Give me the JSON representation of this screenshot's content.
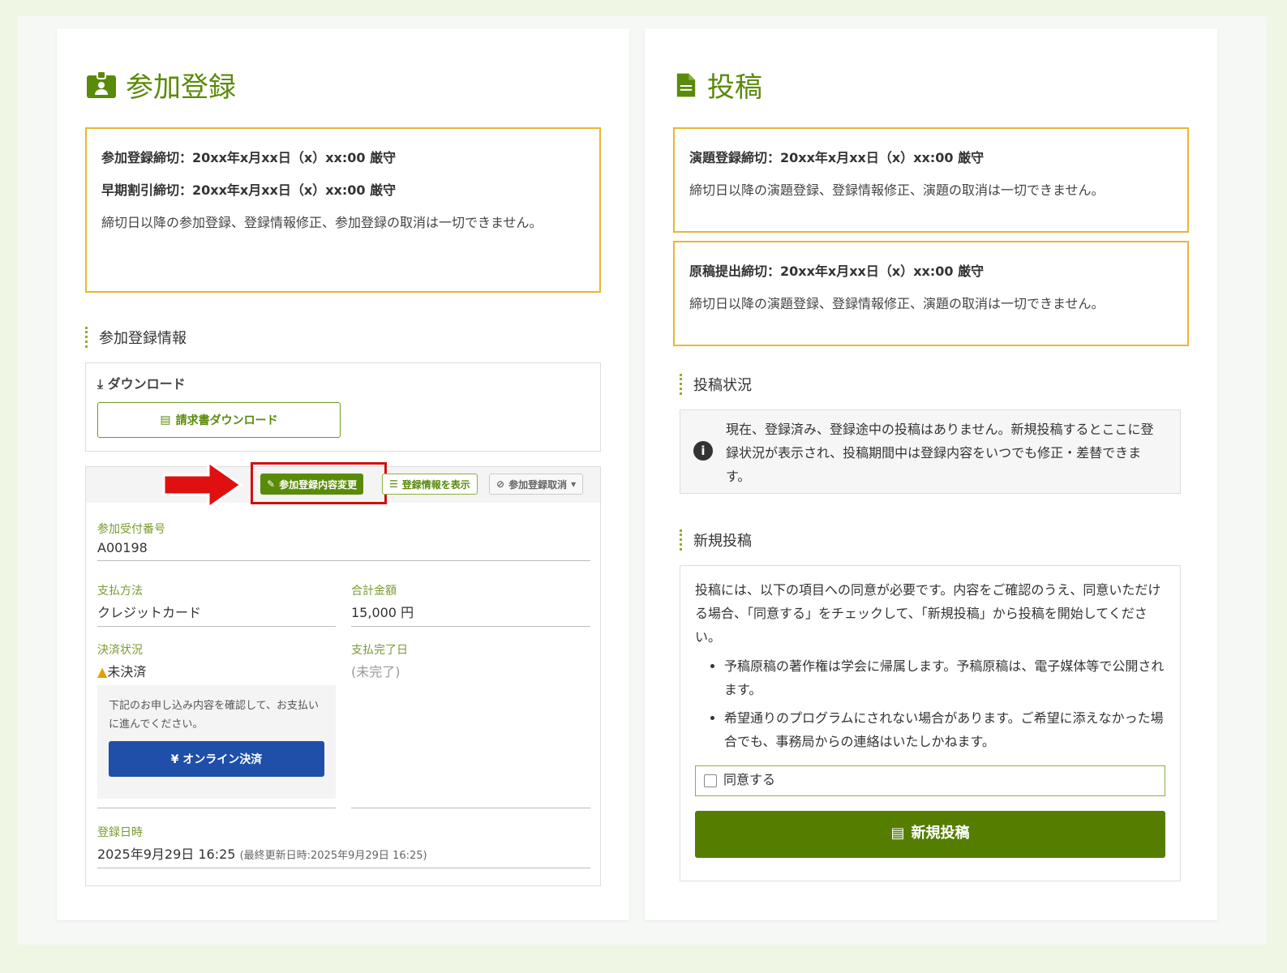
{
  "registration": {
    "title": "参加登録",
    "deadline1": "参加登録締切：20xx年x月xx日（x）xx:00 厳守",
    "deadline2": "早期割引締切：20xx年x月xx日（x）xx:00 厳守",
    "note": "締切日以降の参加登録、登録情報修正、参加登録の取消は一切できません。",
    "section": "参加登録情報",
    "download_label": "ダウンロード",
    "invoice_button": "請求書ダウンロード",
    "edit_button": "参加登録内容変更",
    "view_button": "登録情報を表示",
    "cancel_button": "参加登録取消",
    "receipt_label": "参加受付番号",
    "receipt_value": "A00198",
    "method_label": "支払方法",
    "method_value": "クレジットカード",
    "total_label": "合計金額",
    "total_value": "15,000 円",
    "status_label": "決済状況",
    "status_value": "未決済",
    "paid_label": "支払完了日",
    "paid_value": "(未完了)",
    "pay_note": "下記のお申し込み内容を確認して、お支払いに進んでください。",
    "pay_button": "¥ オンライン決済",
    "date_label": "登録日時",
    "date_value": "2025年9月29日 16:25",
    "updated": "(最終更新日時:2025年9月29日 16:25)"
  },
  "submission": {
    "title": "投稿",
    "deadline1": "演題登録締切：20xx年x月xx日（x）xx:00 厳守",
    "note1": "締切日以降の演題登録、登録情報修正、演題の取消は一切できません。",
    "deadline2": "原稿提出締切：20xx年x月xx日（x）xx:00 厳守",
    "note2": "締切日以降の演題登録、登録情報修正、演題の取消は一切できません。",
    "status_section": "投稿状況",
    "status_info": "現在、登録済み、登録途中の投稿はありません。新規投稿するとここに登録状況が表示され、投稿期間中は登録内容をいつでも修正・差替できます。",
    "new_section": "新規投稿",
    "consent_intro": "投稿には、以下の項目への同意が必要です。内容をご確認のうえ、同意いただける場合、「同意する」をチェックして、「新規投稿」から投稿を開始してください。",
    "items": [
      "予稿原稿の著作権は学会に帰属します。予稿原稿は、電子媒体等で公開されます。",
      "希望通りのプログラムにされない場合があります。ご希望に添えなかった場合でも、事務局からの連絡はいたしかねます。"
    ],
    "agree_label": "同意する",
    "new_button": "新規投稿"
  },
  "colors": {
    "accent": "#5a8a0a",
    "notice": "#e8b830",
    "pay": "#1f4fa8",
    "highlight": "#e01010"
  }
}
